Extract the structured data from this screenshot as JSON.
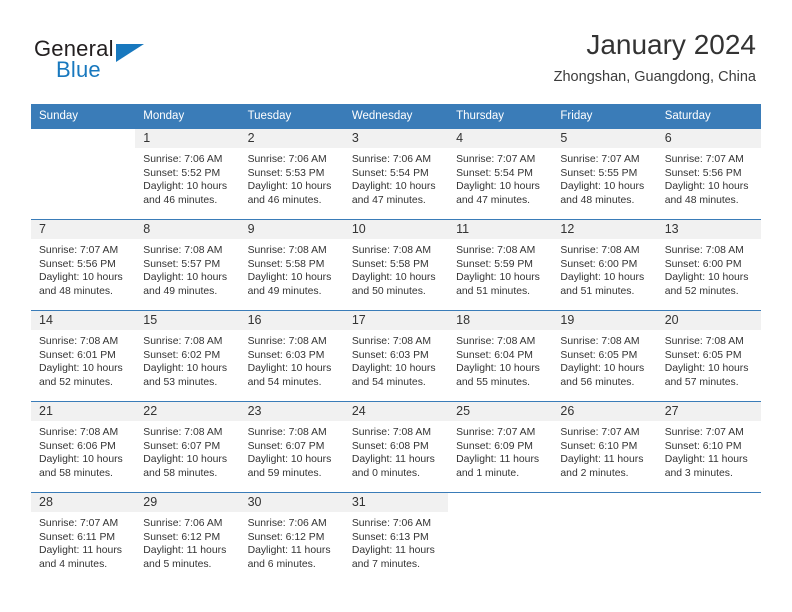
{
  "brand": {
    "name_part1": "General",
    "name_part2": "Blue",
    "accent_color": "#1878be"
  },
  "header": {
    "title": "January 2024",
    "subtitle": "Zhongshan, Guangdong, China",
    "header_bg_color": "#3a7cb8"
  },
  "calendar": {
    "weekday_headers": [
      "Sunday",
      "Monday",
      "Tuesday",
      "Wednesday",
      "Thursday",
      "Friday",
      "Saturday"
    ],
    "weeks": [
      [
        {
          "blank": true
        },
        {
          "day": "1",
          "sunrise": "Sunrise: 7:06 AM",
          "sunset": "Sunset: 5:52 PM",
          "daylight1": "Daylight: 10 hours",
          "daylight2": "and 46 minutes."
        },
        {
          "day": "2",
          "sunrise": "Sunrise: 7:06 AM",
          "sunset": "Sunset: 5:53 PM",
          "daylight1": "Daylight: 10 hours",
          "daylight2": "and 46 minutes."
        },
        {
          "day": "3",
          "sunrise": "Sunrise: 7:06 AM",
          "sunset": "Sunset: 5:54 PM",
          "daylight1": "Daylight: 10 hours",
          "daylight2": "and 47 minutes."
        },
        {
          "day": "4",
          "sunrise": "Sunrise: 7:07 AM",
          "sunset": "Sunset: 5:54 PM",
          "daylight1": "Daylight: 10 hours",
          "daylight2": "and 47 minutes."
        },
        {
          "day": "5",
          "sunrise": "Sunrise: 7:07 AM",
          "sunset": "Sunset: 5:55 PM",
          "daylight1": "Daylight: 10 hours",
          "daylight2": "and 48 minutes."
        },
        {
          "day": "6",
          "sunrise": "Sunrise: 7:07 AM",
          "sunset": "Sunset: 5:56 PM",
          "daylight1": "Daylight: 10 hours",
          "daylight2": "and 48 minutes."
        }
      ],
      [
        {
          "day": "7",
          "sunrise": "Sunrise: 7:07 AM",
          "sunset": "Sunset: 5:56 PM",
          "daylight1": "Daylight: 10 hours",
          "daylight2": "and 48 minutes."
        },
        {
          "day": "8",
          "sunrise": "Sunrise: 7:08 AM",
          "sunset": "Sunset: 5:57 PM",
          "daylight1": "Daylight: 10 hours",
          "daylight2": "and 49 minutes."
        },
        {
          "day": "9",
          "sunrise": "Sunrise: 7:08 AM",
          "sunset": "Sunset: 5:58 PM",
          "daylight1": "Daylight: 10 hours",
          "daylight2": "and 49 minutes."
        },
        {
          "day": "10",
          "sunrise": "Sunrise: 7:08 AM",
          "sunset": "Sunset: 5:58 PM",
          "daylight1": "Daylight: 10 hours",
          "daylight2": "and 50 minutes."
        },
        {
          "day": "11",
          "sunrise": "Sunrise: 7:08 AM",
          "sunset": "Sunset: 5:59 PM",
          "daylight1": "Daylight: 10 hours",
          "daylight2": "and 51 minutes."
        },
        {
          "day": "12",
          "sunrise": "Sunrise: 7:08 AM",
          "sunset": "Sunset: 6:00 PM",
          "daylight1": "Daylight: 10 hours",
          "daylight2": "and 51 minutes."
        },
        {
          "day": "13",
          "sunrise": "Sunrise: 7:08 AM",
          "sunset": "Sunset: 6:00 PM",
          "daylight1": "Daylight: 10 hours",
          "daylight2": "and 52 minutes."
        }
      ],
      [
        {
          "day": "14",
          "sunrise": "Sunrise: 7:08 AM",
          "sunset": "Sunset: 6:01 PM",
          "daylight1": "Daylight: 10 hours",
          "daylight2": "and 52 minutes."
        },
        {
          "day": "15",
          "sunrise": "Sunrise: 7:08 AM",
          "sunset": "Sunset: 6:02 PM",
          "daylight1": "Daylight: 10 hours",
          "daylight2": "and 53 minutes."
        },
        {
          "day": "16",
          "sunrise": "Sunrise: 7:08 AM",
          "sunset": "Sunset: 6:03 PM",
          "daylight1": "Daylight: 10 hours",
          "daylight2": "and 54 minutes."
        },
        {
          "day": "17",
          "sunrise": "Sunrise: 7:08 AM",
          "sunset": "Sunset: 6:03 PM",
          "daylight1": "Daylight: 10 hours",
          "daylight2": "and 54 minutes."
        },
        {
          "day": "18",
          "sunrise": "Sunrise: 7:08 AM",
          "sunset": "Sunset: 6:04 PM",
          "daylight1": "Daylight: 10 hours",
          "daylight2": "and 55 minutes."
        },
        {
          "day": "19",
          "sunrise": "Sunrise: 7:08 AM",
          "sunset": "Sunset: 6:05 PM",
          "daylight1": "Daylight: 10 hours",
          "daylight2": "and 56 minutes."
        },
        {
          "day": "20",
          "sunrise": "Sunrise: 7:08 AM",
          "sunset": "Sunset: 6:05 PM",
          "daylight1": "Daylight: 10 hours",
          "daylight2": "and 57 minutes."
        }
      ],
      [
        {
          "day": "21",
          "sunrise": "Sunrise: 7:08 AM",
          "sunset": "Sunset: 6:06 PM",
          "daylight1": "Daylight: 10 hours",
          "daylight2": "and 58 minutes."
        },
        {
          "day": "22",
          "sunrise": "Sunrise: 7:08 AM",
          "sunset": "Sunset: 6:07 PM",
          "daylight1": "Daylight: 10 hours",
          "daylight2": "and 58 minutes."
        },
        {
          "day": "23",
          "sunrise": "Sunrise: 7:08 AM",
          "sunset": "Sunset: 6:07 PM",
          "daylight1": "Daylight: 10 hours",
          "daylight2": "and 59 minutes."
        },
        {
          "day": "24",
          "sunrise": "Sunrise: 7:08 AM",
          "sunset": "Sunset: 6:08 PM",
          "daylight1": "Daylight: 11 hours",
          "daylight2": "and 0 minutes."
        },
        {
          "day": "25",
          "sunrise": "Sunrise: 7:07 AM",
          "sunset": "Sunset: 6:09 PM",
          "daylight1": "Daylight: 11 hours",
          "daylight2": "and 1 minute."
        },
        {
          "day": "26",
          "sunrise": "Sunrise: 7:07 AM",
          "sunset": "Sunset: 6:10 PM",
          "daylight1": "Daylight: 11 hours",
          "daylight2": "and 2 minutes."
        },
        {
          "day": "27",
          "sunrise": "Sunrise: 7:07 AM",
          "sunset": "Sunset: 6:10 PM",
          "daylight1": "Daylight: 11 hours",
          "daylight2": "and 3 minutes."
        }
      ],
      [
        {
          "day": "28",
          "sunrise": "Sunrise: 7:07 AM",
          "sunset": "Sunset: 6:11 PM",
          "daylight1": "Daylight: 11 hours",
          "daylight2": "and 4 minutes."
        },
        {
          "day": "29",
          "sunrise": "Sunrise: 7:06 AM",
          "sunset": "Sunset: 6:12 PM",
          "daylight1": "Daylight: 11 hours",
          "daylight2": "and 5 minutes."
        },
        {
          "day": "30",
          "sunrise": "Sunrise: 7:06 AM",
          "sunset": "Sunset: 6:12 PM",
          "daylight1": "Daylight: 11 hours",
          "daylight2": "and 6 minutes."
        },
        {
          "day": "31",
          "sunrise": "Sunrise: 7:06 AM",
          "sunset": "Sunset: 6:13 PM",
          "daylight1": "Daylight: 11 hours",
          "daylight2": "and 7 minutes."
        },
        {
          "blank": true
        },
        {
          "blank": true
        },
        {
          "blank": true
        }
      ]
    ]
  }
}
